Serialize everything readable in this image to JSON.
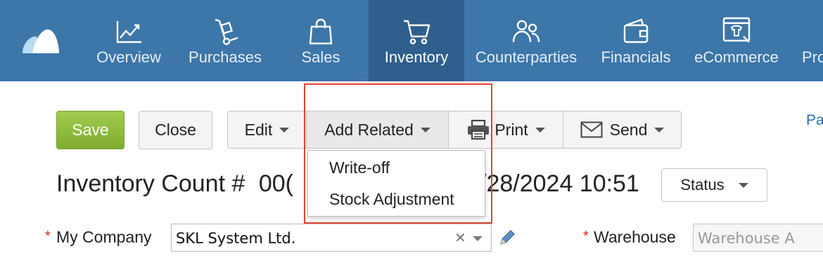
{
  "nav": {
    "items": [
      {
        "label": "Overview",
        "icon": "chart-line-icon"
      },
      {
        "label": "Purchases",
        "icon": "hand-truck-icon"
      },
      {
        "label": "Sales",
        "icon": "shopping-bag-icon"
      },
      {
        "label": "Inventory",
        "icon": "shopping-cart-icon",
        "active": true
      },
      {
        "label": "Counterparties",
        "icon": "users-icon"
      },
      {
        "label": "Financials",
        "icon": "wallet-icon"
      },
      {
        "label": "eCommerce",
        "icon": "web-store-icon"
      },
      {
        "label": "Pro",
        "icon": ""
      }
    ]
  },
  "toolbar": {
    "save_label": "Save",
    "close_label": "Close",
    "edit_label": "Edit",
    "add_related_label": "Add Related",
    "print_label": "Print",
    "send_label": "Send",
    "pa_link": "Pa"
  },
  "dropdown": {
    "items": [
      "Write-off",
      "Stock Adjustment"
    ]
  },
  "document": {
    "title_prefix": "Inventory Count #",
    "number_visible": "00(",
    "datetime_visible": "/28/2024 10:51",
    "status_label": "Status"
  },
  "form": {
    "required_mark": "*",
    "company_label": "My Company",
    "company_value": "SKL System Ltd.",
    "warehouse_label": "Warehouse",
    "warehouse_value": "Warehouse A"
  },
  "colors": {
    "navbar": "#3d76a8",
    "navbar_active": "#2f5f8c",
    "save_button": "#8dbb3d",
    "highlight": "#e0452f",
    "link": "#2d6da7"
  }
}
